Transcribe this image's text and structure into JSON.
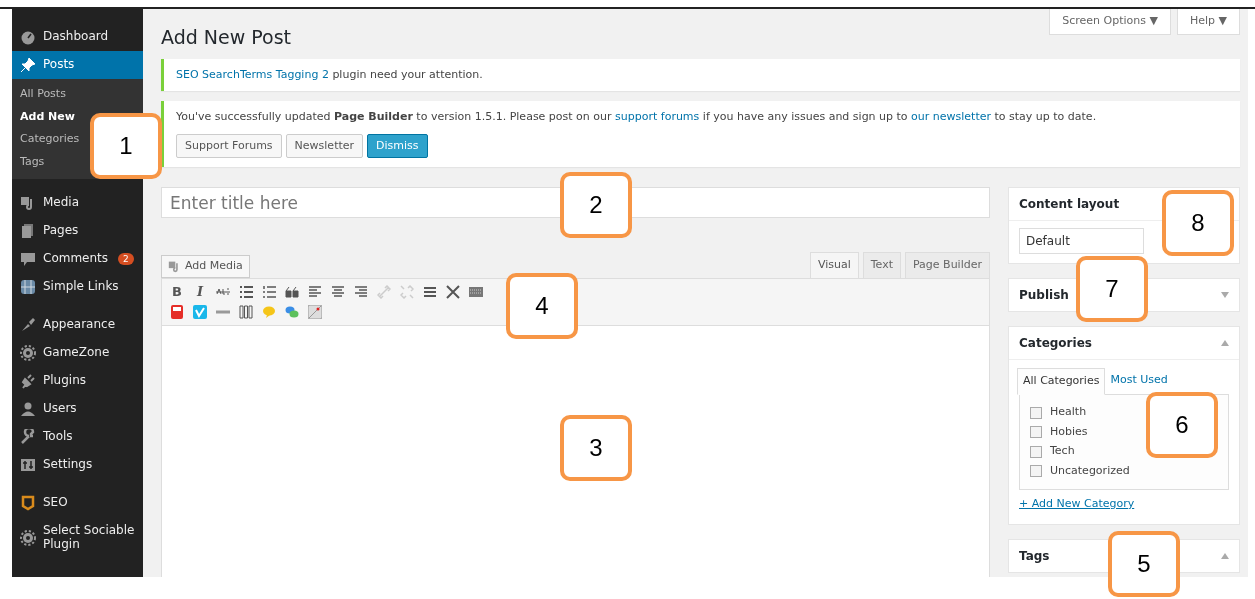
{
  "sidebar": {
    "items": [
      {
        "label": "Dashboard",
        "selected": false
      },
      {
        "label": "Posts",
        "selected": true,
        "children": [
          {
            "label": "All Posts",
            "selected": false
          },
          {
            "label": "Add New",
            "selected": true
          },
          {
            "label": "Categories",
            "selected": false
          },
          {
            "label": "Tags",
            "selected": false
          }
        ]
      },
      {
        "label": "Media",
        "selected": false
      },
      {
        "label": "Pages",
        "selected": false
      },
      {
        "label": "Comments",
        "selected": false,
        "badge": "2"
      },
      {
        "label": "Simple Links",
        "selected": false
      },
      {
        "label": "Appearance",
        "selected": false
      },
      {
        "label": "GameZone",
        "selected": false
      },
      {
        "label": "Plugins",
        "selected": false
      },
      {
        "label": "Users",
        "selected": false
      },
      {
        "label": "Tools",
        "selected": false
      },
      {
        "label": "Settings",
        "selected": false
      },
      {
        "label": "SEO",
        "selected": false
      },
      {
        "label": "Select Sociable Plugin",
        "selected": false
      }
    ]
  },
  "header": {
    "title": "Add New Post",
    "buttons": [
      "Screen Options ▼",
      "Help ▼"
    ]
  },
  "notices": [
    {
      "link": "SEO SearchTerms Tagging 2",
      "text": " plugin need your attention."
    },
    {
      "text": "You've successfully updated **Page Builder** to version 1.5.1. Please post on our ",
      "link": "support forums",
      "text2": " if you have any issues and sign up to ",
      "link2": "our newsletter",
      "text3": " to stay up to date.",
      "buttons": [
        {
          "label": "Support Forums",
          "primary": false
        },
        {
          "label": "Newsletter",
          "primary": false
        },
        {
          "label": "Dismiss",
          "primary": true
        }
      ]
    }
  ],
  "title_field": {
    "placeholder": "Enter title here"
  },
  "editor": {
    "add_media": "Add Media",
    "tabs": [
      {
        "label": "Visual",
        "selected": true
      },
      {
        "label": "Text",
        "selected": false
      },
      {
        "label": "Page Builder",
        "selected": false
      }
    ],
    "bold": "B",
    "italic": "I"
  },
  "boxes": [
    {
      "title": "Content layout",
      "kind": "select",
      "value": "Default"
    },
    {
      "title": "Publish",
      "kind": "collapsed"
    },
    {
      "title": "Categories",
      "kind": "categories",
      "tabs": [
        {
          "label": "All Categories",
          "selected": true
        },
        {
          "label": "Most Used",
          "selected": false
        }
      ],
      "items": [
        {
          "label": "Health",
          "checked": false
        },
        {
          "label": "Hobies",
          "checked": false
        },
        {
          "label": "Tech",
          "checked": false
        },
        {
          "label": "Uncategorized",
          "checked": false
        }
      ],
      "add_link": "+ Add New Category"
    },
    {
      "title": "Tags",
      "kind": "open"
    }
  ],
  "callouts": [
    "1",
    "2",
    "3",
    "4",
    "5",
    "6",
    "7",
    "8"
  ]
}
